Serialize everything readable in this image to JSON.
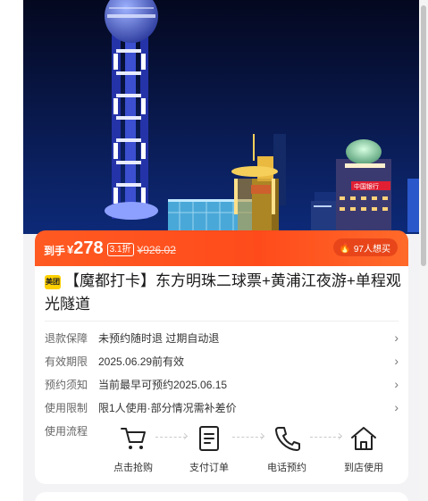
{
  "hero": {
    "image": "shanghai-oriental-pearl-tower-night",
    "sign_text": "中国银行"
  },
  "price": {
    "label": "到手",
    "currency": "¥",
    "amount": "278",
    "discount": "3.1折",
    "original": "¥926.02",
    "wish_count": "97人想买",
    "accent": "#ff5a22"
  },
  "product": {
    "brand_badge": "美团",
    "title": "【魔都打卡】东方明珠二球票+黄浦江夜游+单程观光隧道"
  },
  "info": [
    {
      "key": "退款保障",
      "value": "未预约随时退 过期自动退"
    },
    {
      "key": "有效期限",
      "value": "2025.06.29前有效"
    },
    {
      "key": "预约须知",
      "value": "当前最早可预约2025.06.15"
    },
    {
      "key": "使用限制",
      "value": "限1人使用·部分情况需补差价"
    }
  ],
  "flow": {
    "label": "使用流程",
    "steps": [
      {
        "label": "点击抢购",
        "icon": "cart-icon"
      },
      {
        "label": "支付订单",
        "icon": "order-icon"
      },
      {
        "label": "电话预约",
        "icon": "phone-icon"
      },
      {
        "label": "到店使用",
        "icon": "home-icon"
      }
    ]
  }
}
